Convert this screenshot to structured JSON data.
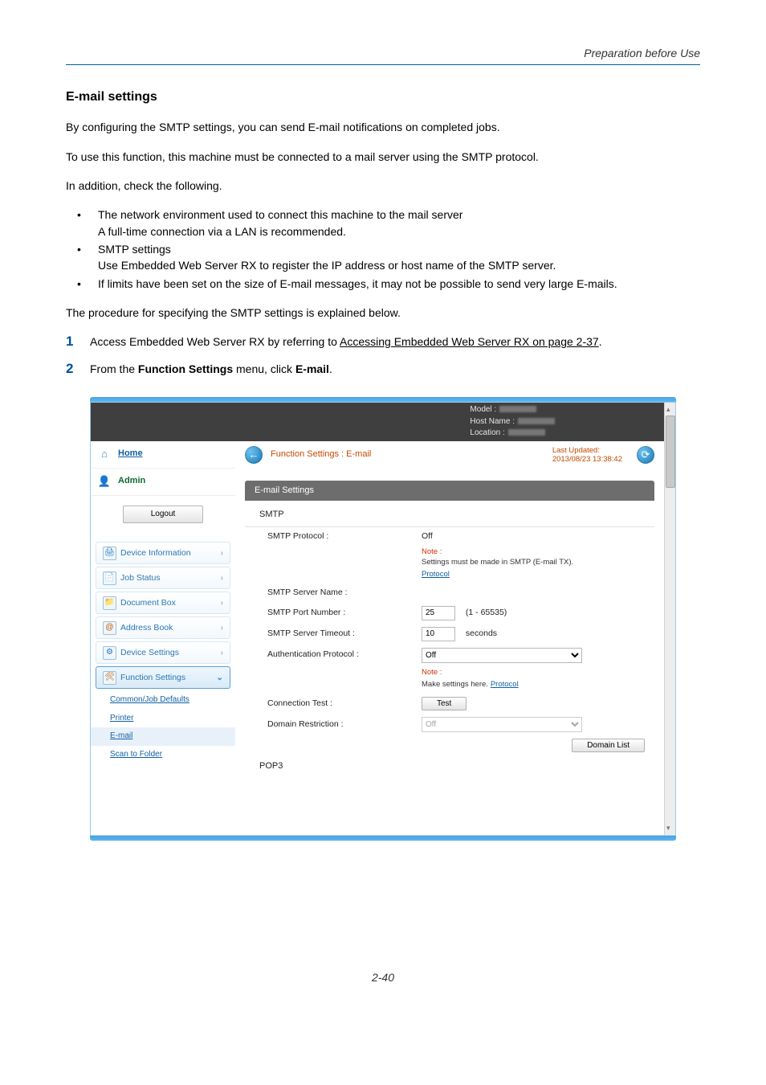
{
  "header": {
    "right": "Preparation before Use"
  },
  "section_title": "E-mail settings",
  "paras": {
    "p1": "By configuring the SMTP settings, you can send E-mail notifications on completed jobs.",
    "p2": "To use this function, this machine must be connected to a mail server using the SMTP protocol.",
    "p3": "In addition, check the following.",
    "p4": "The procedure for specifying the SMTP settings is explained below."
  },
  "bullets": [
    {
      "line1": "The network environment used to connect this machine to the mail server",
      "line2": "A full-time connection via a LAN is recommended."
    },
    {
      "line1": "SMTP settings",
      "line2": "Use Embedded Web Server RX to register the IP address or host name of the SMTP server."
    },
    {
      "line1": "If limits have been set on the size of E-mail messages, it may not be possible to send very large E-mails.",
      "line2": ""
    }
  ],
  "steps": [
    {
      "prefix": "Access Embedded Web Server RX by referring to ",
      "link": "Accessing Embedded Web Server RX on page 2-37",
      "suffix": "."
    },
    {
      "prefix": "From the ",
      "bold1": "Function Settings",
      "mid": " menu, click ",
      "bold2": "E-mail",
      "suffix": "."
    }
  ],
  "shot": {
    "topband": {
      "model": "Model :",
      "host": "Host Name :",
      "loc": "Location :"
    },
    "nav": {
      "home": "Home",
      "admin": "Admin",
      "logout": "Logout",
      "items": [
        {
          "label": "Device Information"
        },
        {
          "label": "Job Status"
        },
        {
          "label": "Document Box"
        },
        {
          "label": "Address Book"
        },
        {
          "label": "Device Settings"
        },
        {
          "label": "Function Settings"
        }
      ],
      "subs": [
        "Common/Job Defaults",
        "Printer",
        "E-mail",
        "Scan to Folder"
      ]
    },
    "crumb": "Function Settings : E-mail",
    "last_updated_label": "Last Updated:",
    "last_updated_value": "2013/08/23 13:38:42",
    "panel_title": "E-mail Settings",
    "smtp_header": "SMTP",
    "rows": {
      "protocol_label": "SMTP Protocol :",
      "protocol_value": "Off",
      "note1a": "Note :",
      "note1b": "Settings must be made in SMTP (E-mail TX).",
      "protocol_link": "Protocol",
      "server_name": "SMTP Server Name :",
      "port_label": "SMTP Port Number :",
      "port_value": "25",
      "port_hint": "(1 - 65535)",
      "timeout_label": "SMTP Server Timeout :",
      "timeout_value": "10",
      "timeout_unit": "seconds",
      "auth_label": "Authentication Protocol :",
      "auth_value": "Off",
      "note2a": "Note :",
      "note2b": "Make settings here.",
      "conn_test_label": "Connection Test :",
      "test_btn": "Test",
      "domain_restrict_label": "Domain Restriction :",
      "domain_restrict_value": "Off",
      "domain_list_btn": "Domain List"
    },
    "pop3_header": "POP3"
  },
  "page_number": "2-40"
}
